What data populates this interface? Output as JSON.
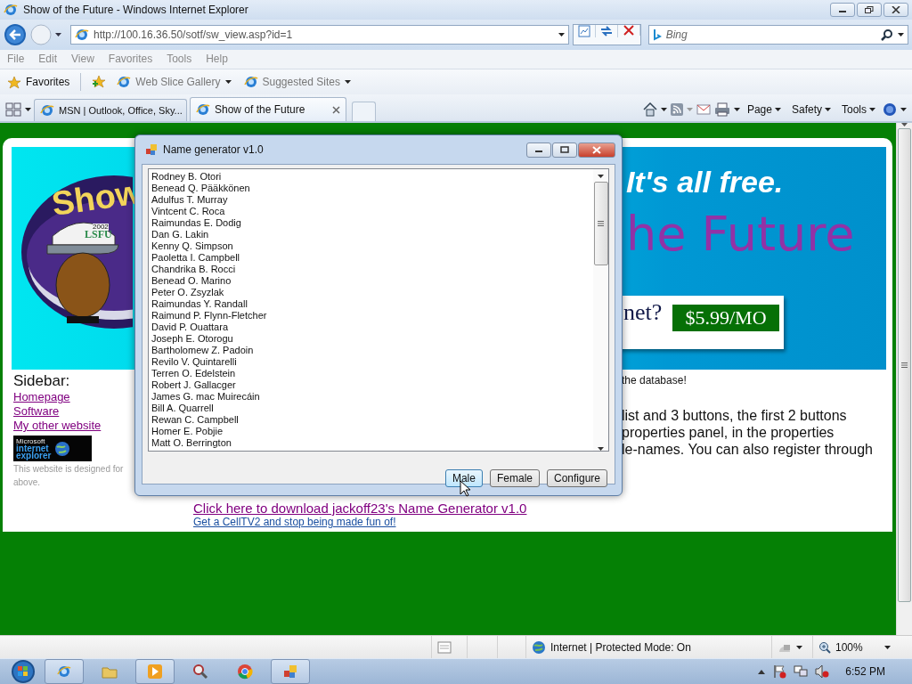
{
  "window": {
    "title": "Show of the Future - Windows Internet Explorer"
  },
  "address_bar": {
    "url": "http://100.16.36.50/sotf/sw_view.asp?id=1"
  },
  "search": {
    "placeholder": "Bing"
  },
  "menu": [
    "File",
    "Edit",
    "View",
    "Favorites",
    "Tools",
    "Help"
  ],
  "favorites_bar": {
    "label": "Favorites",
    "items": [
      "Web Slice Gallery",
      "Suggested Sites"
    ]
  },
  "tabs": [
    {
      "label": "MSN | Outlook, Office, Sky...",
      "selected": false
    },
    {
      "label": "Show of the Future",
      "selected": true
    }
  ],
  "command_bar": [
    "Page",
    "Safety",
    "Tools"
  ],
  "page": {
    "banner": {
      "logo_text": "Show",
      "cap_year": "2002",
      "cap_text": "LSFU",
      "slogan": "It's all free.",
      "title_fragment": "he Future",
      "ad_question": "net?",
      "ad_price": "$5.99/MO"
    },
    "sidebar": {
      "heading": "Sidebar:",
      "links": [
        "Homepage",
        "Software",
        "My other website"
      ],
      "badge": [
        "Microsoft",
        "internet",
        "explorer"
      ],
      "note": [
        "This website is designed for",
        "above."
      ]
    },
    "content": {
      "intro": "the database!",
      "paragraph": [
        "list and 3 buttons, the first 2 buttons",
        "properties panel, in the properties",
        "le-names. You can also register through"
      ],
      "links": [
        {
          "label": "Click here to download jackoff23's Name Generator v1.0",
          "visited": true
        },
        {
          "label": "Get a CellTV2 and stop being made fun of!",
          "visited": false
        }
      ]
    }
  },
  "dialog": {
    "title": "Name generator v1.0",
    "names": [
      "Rodney B. Otori",
      "Benead Q. Pääkkönen",
      "Adulfus T. Murray",
      "Vintcent C. Roca",
      "Raimundas E. Dodig",
      "Dan G. Lakin",
      "Kenny Q. Simpson",
      "Paoletta I. Campbell",
      "Chandrika B. Rocci",
      "Benead O. Marino",
      "Peter O. Zsyzlak",
      "Raimundas Y. Randall",
      "Raimund P. Flynn-Fletcher",
      "David P. Ouattara",
      "Joseph E. Otorogu",
      "Bartholomew Z. Padoin",
      "Revilo V. Quintarelli",
      "Terren O. Edelstein",
      "Robert J. Gallacger",
      "James G. mac Muirecáin",
      "Bill A. Quarrell",
      "Rewan C. Campbell",
      "Homer E. Pobjie",
      "Matt O. Berrington"
    ],
    "buttons": [
      {
        "label": "Male",
        "hovered": true
      },
      {
        "label": "Female",
        "hovered": false
      },
      {
        "label": "Configure",
        "hovered": false
      }
    ]
  },
  "status_bar": {
    "zone": "Internet | Protected Mode: On",
    "zoom": "100%"
  },
  "taskbar": {
    "time": "6:52 PM"
  }
}
